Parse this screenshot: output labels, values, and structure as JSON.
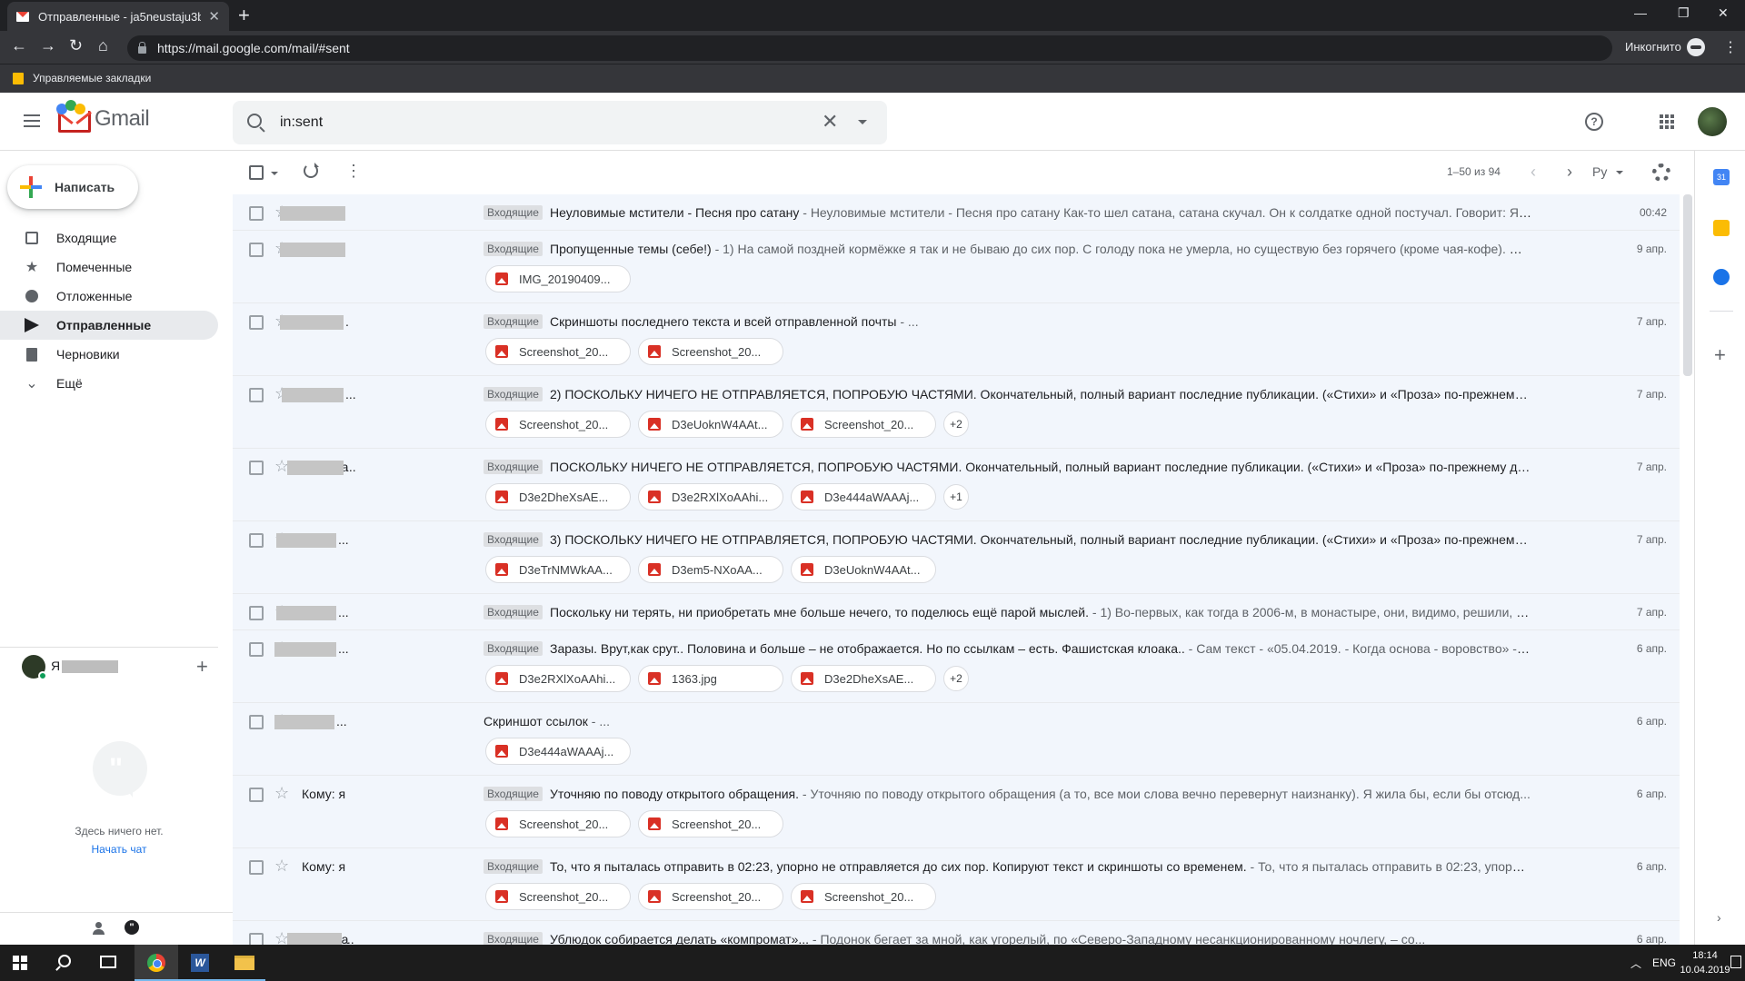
{
  "browser": {
    "tab_title": "Отправленные - ja5neustaju3by",
    "url": "https://mail.google.com/mail/#sent",
    "incognito_label": "Инкогнито",
    "bookmarks_label": "Управляемые закладки"
  },
  "header": {
    "logo_text": "Gmail",
    "search_query": "in:sent"
  },
  "sidebar": {
    "compose_label": "Написать",
    "items": [
      {
        "label": "Входящие",
        "icon": "inbox-icon"
      },
      {
        "label": "Помеченные",
        "icon": "star-icon"
      },
      {
        "label": "Отложенные",
        "icon": "clock-icon"
      },
      {
        "label": "Отправленные",
        "icon": "send-icon",
        "active": true
      },
      {
        "label": "Черновики",
        "icon": "draft-icon"
      },
      {
        "label": "Ещё",
        "icon": "chevron-down-icon"
      }
    ],
    "hangouts_user": "Я",
    "empty_text": "Здесь ничего нет.",
    "start_chat": "Начать чат"
  },
  "listbar": {
    "count": "1–50 из 94",
    "lang": "Ру"
  },
  "emails": [
    {
      "to": "Кому: j",
      "tag": "Входящие",
      "subject": "Неуловимые мстители - Песня про сатану",
      "snippet": " - Неуловимые мстители - Песня про сатану Как-то шел сатана, сатана скучал. Он к солдатке одной постучал. Говорит: Я те...",
      "date": "00:42",
      "attachments": [],
      "more": ""
    },
    {
      "to": "Кому: j",
      "tag": "Входящие",
      "subject": "Пропущенные темы (себе!)",
      "snippet": " - 1) На самой поздней кормёжке я так и не бываю до сих пор. С голоду пока не умерла, но существую без горячего (кроме чая-кофе). Ме...",
      "date": "9 апр.",
      "attachments": [
        "IMG_20190409..."
      ],
      "more": ""
    },
    {
      "to": "Кому: j",
      "tag": "Входящие",
      "subject": "Скриншоты последнего текста и всей отправленной почты",
      "snippet": " - ...",
      "date": "7 апр.",
      "attachments": [
        "Screenshot_20...",
        "Screenshot_20..."
      ],
      "more": ""
    },
    {
      "to": "Кому: j",
      "tag": "Входящие",
      "subject": "2) ПОСКОЛЬКУ НИЧЕГО НЕ ОТПРАВЛЯЕТСЯ, ПОПРОБУЮ ЧАСТЯМИ. Окончательный, полный вариант последние публикации. («Стихи» и «Проза» по-прежнему дурят,...",
      "snippet": "",
      "date": "7 апр.",
      "attachments": [
        "Screenshot_20...",
        "D3eUoknW4AAt...",
        "Screenshot_20..."
      ],
      "more": "+2"
    },
    {
      "to": "Кому: ja",
      "tag": "Входящие",
      "subject": "ПОСКОЛЬКУ НИЧЕГО НЕ ОТПРАВЛЯЕТСЯ, ПОПРОБУЮ ЧАСТЯМИ. Окончательный, полный вариант последние публикации. («Стихи» и «Проза» по-прежнему дурят, п...",
      "snippet": "",
      "date": "7 апр.",
      "attachments": [
        "D3e2DheXsAE...",
        "D3e2RXlXoAAhi...",
        "D3e444aWAAAj..."
      ],
      "more": "+1"
    },
    {
      "to": "Кому:",
      "tag": "Входящие",
      "subject": "3) ПОСКОЛЬКУ НИЧЕГО НЕ ОТПРАВЛЯЕТСЯ, ПОПРОБУЮ ЧАСТЯМИ. Окончательный, полный вариант последние публикации. («Стихи» и «Проза» по-прежнему дурят,...",
      "snippet": "",
      "date": "7 апр.",
      "attachments": [
        "D3eTrNMWkAA...",
        "D3em5-NXoAA...",
        "D3eUoknW4AAt..."
      ],
      "more": ""
    },
    {
      "to": "Кому:",
      "tag": "Входящие",
      "subject": "Поскольку ни терять, ни приобретать мне больше нечего, то поделюсь ещё парой мыслей.",
      "snippet": " - 1) Во-первых, как тогда в 2006-м, в монастыре, они, видимо, решили, что...",
      "date": "7 апр.",
      "attachments": [],
      "more": ""
    },
    {
      "to": "Кому:",
      "tag": "Входящие",
      "subject": "Заразы. Врут,как срут.. Половина и больше – не отображается. Но по ссылкам – есть. Фашистская клоака..",
      "snippet": " - Сам текст - «05.04.2019. - Когда основа - воровство» - ht...",
      "date": "6 апр.",
      "attachments": [
        "D3e2RXlXoAAhi...",
        "1363.jpg",
        "D3e2DheXsAE..."
      ],
      "more": "+2"
    },
    {
      "to": "Кому:",
      "tag": "",
      "subject": "Скриншот ссылок",
      "snippet": " - ...",
      "date": "6 апр.",
      "attachments": [
        "D3e444aWAAAj..."
      ],
      "more": ""
    },
    {
      "to": "Кому: я",
      "tag": "Входящие",
      "subject": "Уточняю по поводу открытого обращения.",
      "snippet": " - Уточняю по поводу открытого обращения (а то, все мои слова вечно перевернут   наизнанку). Я жила бы, если бы отсюд...",
      "date": "6 апр.",
      "attachments": [
        "Screenshot_20...",
        "Screenshot_20..."
      ],
      "more": ""
    },
    {
      "to": "Кому: я",
      "tag": "Входящие",
      "subject": "То, что я пыталась отправить в 02:23, упорно не отправляется до сих пор. Копируют текст и скриншоты со временем.",
      "snippet": " - То, что я пыталась отправить в 02:23, упорно ...",
      "date": "6 апр.",
      "attachments": [
        "Screenshot_20...",
        "Screenshot_20...",
        "Screenshot_20..."
      ],
      "more": ""
    },
    {
      "to": "Кому: ja",
      "tag": "Входящие",
      "subject": "Ублюдок           собирается делать «компромат»...",
      "snippet": " - Подонок           бегает за мной, как угорелый, по «Северо-Западному несанкционированному ночлегу, – со...",
      "date": "6 апр.",
      "attachments": [],
      "more": ""
    }
  ],
  "taskbar": {
    "lang": "ENG",
    "time": "18:14",
    "date": "10.04.2019"
  }
}
